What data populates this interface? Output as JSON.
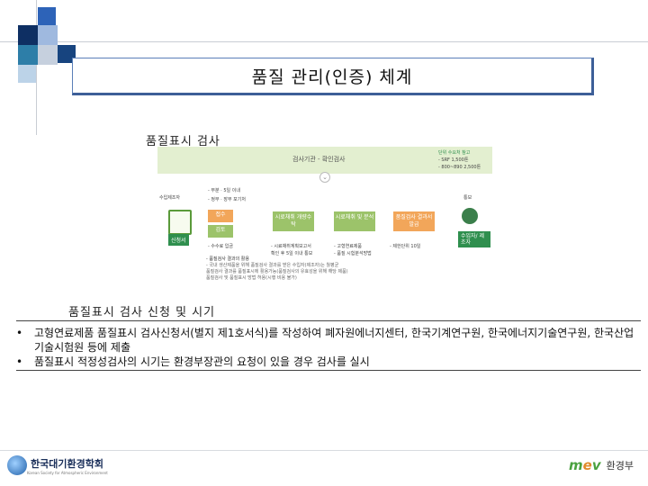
{
  "title": "품질 관리(인증) 체계",
  "caption_top": "품질표시 검사",
  "caption_mid": "품질표시 검사 신청 및 시기",
  "diagram": {
    "top_header": "검사기관 - 확인검사",
    "right_notes": [
      "단위 수요처 참고",
      "- SRF 1,500톤",
      "- 800~890 2,500톤"
    ],
    "left_actor": "수입제조자",
    "left_tag": "신청서",
    "left_notes": [
      "- 부분 · 5일 이내",
      "- 정부 · 장부 포기처"
    ],
    "steps": [
      "접수",
      "검토",
      "시료채취 개량수탁",
      "시료채취 및 분석",
      "품질검사 결과서 발급"
    ],
    "right_actor": "통보",
    "right_tag": "수입자/ 제조자",
    "sub_notes": [
      "- 수수료 입금",
      "- 시료채취계획보고서",
      "- 고형연료제품",
      "- 제한단위 10일",
      "확인 후 5일 이내 통보",
      "- 품질 시험분석방법"
    ],
    "bottom_notes": [
      "- 품질검사 결과의 활용",
      "- 국내 생산제품을 위해 품질검사 결과를 받은 수입자(제조자)는 월평균",
      "품질검사 결과를 품질표시에 활용가능(품질검사의 유효성을 위해 해당 제품)",
      "품질검사 및 품질표시 방법 허용(시행 비용 불가)"
    ]
  },
  "bullets": [
    "고형연료제품 품질표시 검사신청서(별지 제1호서식)를 작성하여 폐자원에너지센터, 한국기계연구원, 한국에너지기술연구원, 한국산업기술시험원 등에 제출",
    "품질표시 적정성검사의 시기는 환경부장관의 요청이 있을 경우 검사를 실시"
  ],
  "bullet_symbol": "•",
  "footer": {
    "left_org": "한국대기환경학회",
    "left_sub": "Korean Society for Atmospheric Environment",
    "right_mark_a": "m",
    "right_mark_b": "e",
    "right_mark_c": "v",
    "right_org": "환경부"
  },
  "colors": {
    "title_border": "#3d5f98",
    "diagram_green": "#9cc36a",
    "diagram_orange": "#f2a65a",
    "brand_green": "#4aa13f"
  }
}
